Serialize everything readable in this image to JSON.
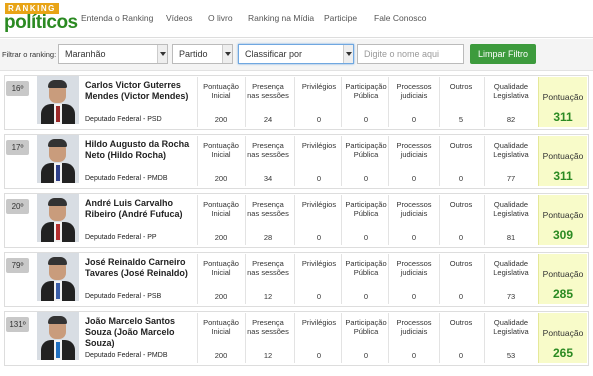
{
  "header": {
    "logo_top": "RANKING",
    "logo_main": "políticos",
    "nav": [
      "Entenda o Ranking",
      "Vídeos",
      "O livro",
      "Ranking na Mídia",
      "Participe",
      "Fale Conosco"
    ]
  },
  "filters": {
    "label": "Filtrar o ranking:",
    "state": "Maranhão",
    "party": "Partido",
    "sort": "Classificar por",
    "name_placeholder": "Digite o nome aqui",
    "clear_button": "Limpar Filtro"
  },
  "columns": {
    "pontuacao_inicial": "Pontuação Inicial",
    "presenca": "Presença nas sessões",
    "privilegios": "Privilégios",
    "participacao": "Participação Pública",
    "processos": "Processos judiciais",
    "outros": "Outros",
    "qualidade": "Qualidade Legislativa",
    "pontuacao": "Pontuação"
  },
  "politicians": [
    {
      "rank": "16º",
      "name": "Carlos Victor Guterres Mendes (Victor Mendes)",
      "party": "Deputado Federal - PSD",
      "inicial": "200",
      "presenca": "24",
      "privilegios": "0",
      "participacao": "0",
      "processos": "0",
      "outros": "5",
      "qualidade": "82",
      "pontuacao": "311",
      "tie_color": "#9c2a2a"
    },
    {
      "rank": "17º",
      "name": "Hildo Augusto da Rocha Neto (Hildo Rocha)",
      "party": "Deputado Federal - PMDB",
      "inicial": "200",
      "presenca": "34",
      "privilegios": "0",
      "participacao": "0",
      "processos": "0",
      "outros": "0",
      "qualidade": "77",
      "pontuacao": "311",
      "tie_color": "#2e3f8a"
    },
    {
      "rank": "20º",
      "name": "André Luis Carvalho Ribeiro (André Fufuca)",
      "party": "Deputado Federal - PP",
      "inicial": "200",
      "presenca": "28",
      "privilegios": "0",
      "participacao": "0",
      "processos": "0",
      "outros": "0",
      "qualidade": "81",
      "pontuacao": "309",
      "tie_color": "#b53030"
    },
    {
      "rank": "79º",
      "name": "José Reinaldo Carneiro Tavares (José Reinaldo)",
      "party": "Deputado Federal - PSB",
      "inicial": "200",
      "presenca": "12",
      "privilegios": "0",
      "participacao": "0",
      "processos": "0",
      "outros": "0",
      "qualidade": "73",
      "pontuacao": "285",
      "tie_color": "#3a5ea8"
    },
    {
      "rank": "131º",
      "name": "João Marcelo Santos Souza (João Marcelo Souza)",
      "party": "Deputado Federal - PMDB",
      "inicial": "200",
      "presenca": "12",
      "privilegios": "0",
      "participacao": "0",
      "processos": "0",
      "outros": "0",
      "qualidade": "53",
      "pontuacao": "265",
      "tie_color": "#1f6fc0"
    }
  ]
}
